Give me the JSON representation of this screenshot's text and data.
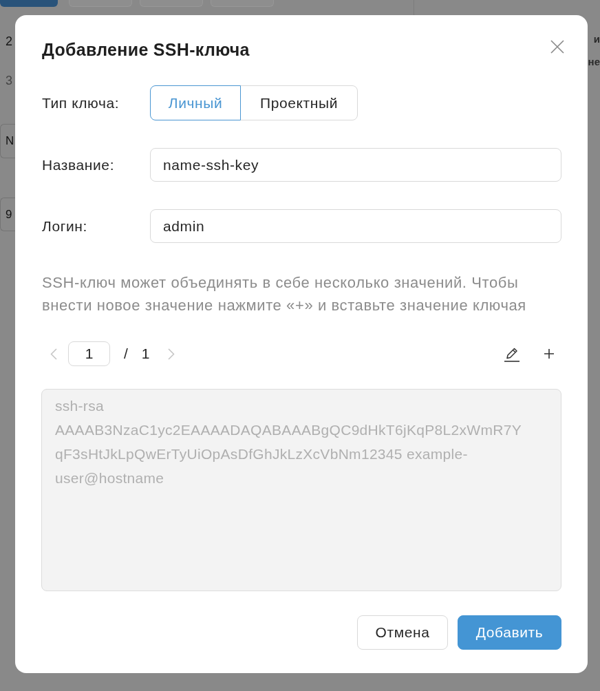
{
  "background_page": {
    "steps": [
      {
        "label": "2",
        "disabled": false
      },
      {
        "label": "3",
        "disabled": true
      }
    ],
    "fields": [
      {
        "value": "N"
      },
      {
        "value": "9"
      }
    ],
    "heading_fragments": [
      "и",
      "не"
    ]
  },
  "dialog": {
    "title": "Добавление SSH-ключа",
    "key_type": {
      "label": "Тип ключа:",
      "options": [
        {
          "label": "Личный",
          "selected": true
        },
        {
          "label": "Проектный",
          "selected": false
        }
      ]
    },
    "fields": [
      {
        "label": "Название:",
        "value": "name-ssh-key"
      },
      {
        "label": "Логин:",
        "value": "admin"
      }
    ],
    "hint": "SSH-ключ может объединять в себе несколько значений. Чтобы внести новое значение нажмите «+» и вставьте значение ключая",
    "pager": {
      "previous": {
        "disabled": true
      },
      "page": "1",
      "separator": "/",
      "total": "1",
      "next": {
        "disabled": true
      }
    },
    "key_value": {
      "value": "ssh-rsa AAAAB3NzaC1yc2EAAAADAQABAAABgQC9dHkT6jKqP8L2xWmR7Y qF3sHtJkLpQwErTyUiOpAsDfGhJkLzXcVbNm12345 example-user@hostname",
      "disabled": true
    },
    "buttons": [
      {
        "label": "Отмена",
        "kind": "secondary"
      },
      {
        "label": "Добавить",
        "kind": "primary"
      }
    ]
  }
}
